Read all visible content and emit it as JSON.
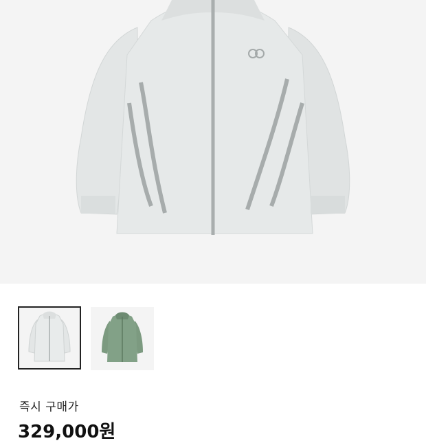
{
  "product": {
    "images": [
      {
        "name": "light-gray-jacket",
        "color": "#e4e7e7",
        "selected": true
      },
      {
        "name": "sage-green-jacket",
        "color": "#7f9e84",
        "selected": false
      }
    ]
  },
  "purchase": {
    "label": "즉시 구매가",
    "price": "329,000원"
  }
}
